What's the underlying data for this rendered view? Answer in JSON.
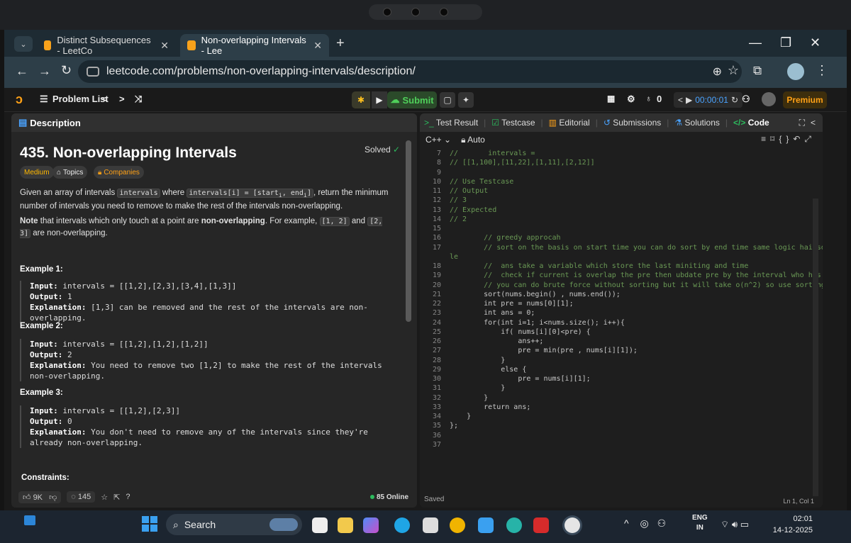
{
  "browser": {
    "tabs": [
      {
        "title": "Distinct Subsequences - LeetCo",
        "active": false
      },
      {
        "title": "Non-overlapping Intervals - Lee",
        "active": true
      }
    ],
    "url": "leetcode.com/problems/non-overlapping-intervals/description/"
  },
  "header": {
    "problem_list": "Problem List",
    "submit": "Submit",
    "streak": "0",
    "timer": "00:00:01",
    "premium": "Premium"
  },
  "left": {
    "tab": "Description",
    "title": "435. Non-overlapping Intervals",
    "solved": "Solved",
    "chips": {
      "difficulty": "Medium",
      "topics": "Topics",
      "companies": "Companies"
    },
    "desc_prefix": "Given an array of intervals",
    "desc_code1": "intervals",
    "desc_mid": "where",
    "desc_code2": "intervals[i] = [start",
    "desc_code2_tail": ", end",
    "desc_code2_end": "]",
    "desc_suffix": ", return the minimum number of intervals you need to remove to make the rest of the intervals non-overlapping.",
    "note_bold": "Note",
    "note_text": "that intervals which only touch at a point are",
    "note_bold2": "non-overlapping",
    "note_text2": ". For example,",
    "note_code1": "[1, 2]",
    "note_and": "and",
    "note_code2": "[2, 3]",
    "note_end": "are non-overlapping.",
    "examples": [
      {
        "title": "Example 1:",
        "input": "intervals = [[1,2],[2,3],[3,4],[1,3]]",
        "output": "1",
        "explanation": "[1,3] can be removed and the rest of the intervals are non-overlapping."
      },
      {
        "title": "Example 2:",
        "input": "intervals = [[1,2],[1,2],[1,2]]",
        "output": "2",
        "explanation": "You need to remove two [1,2] to make the rest of the intervals non-overlapping."
      },
      {
        "title": "Example 3:",
        "input": "intervals = [[1,2],[2,3]]",
        "output": "0",
        "explanation": "You don't need to remove any of the intervals since they're already non-overlapping."
      }
    ],
    "labels": {
      "input": "Input:",
      "output": "Output:",
      "explanation": "Explanation:"
    },
    "constraints": "Constraints:",
    "footer": {
      "likes": "9K",
      "comments": "145",
      "online": "85 Online"
    }
  },
  "right": {
    "tabs": {
      "test_result": "Test Result",
      "testcase": "Testcase",
      "editorial": "Editorial",
      "submissions": "Submissions",
      "solutions": "Solutions",
      "code": "Code"
    },
    "language": "C++",
    "auto": "Auto",
    "saved": "Saved",
    "cursor": "Ln 1, Col 1",
    "lines": [
      {
        "n": "7",
        "text": "//       intervals =",
        "kind": "cm"
      },
      {
        "n": "8",
        "text": "// [[1,100],[11,22],[1,11],[2,12]]",
        "kind": "cm"
      },
      {
        "n": "9",
        "text": "",
        "kind": "cm"
      },
      {
        "n": "10",
        "text": "// Use Testcase",
        "kind": "cm"
      },
      {
        "n": "11",
        "text": "// Output",
        "kind": "cm"
      },
      {
        "n": "12",
        "text": "// 3",
        "kind": "cm"
      },
      {
        "n": "13",
        "text": "// Expected",
        "kind": "cm"
      },
      {
        "n": "14",
        "text": "// 2",
        "kind": "cm"
      },
      {
        "n": "15",
        "text": "",
        "kind": "cm"
      },
      {
        "n": "16",
        "text": "        // greedy approcah",
        "kind": "cm"
      },
      {
        "n": "17",
        "text": "        // sort on the basis on start time you can do sort by end time same logic hai soch ke kr",
        "kind": "cm"
      },
      {
        "n": "",
        "text": "le",
        "kind": "cm"
      },
      {
        "n": "18",
        "text": "        //  ans take a variable which store the last miniting and time",
        "kind": "cm"
      },
      {
        "n": "19",
        "text": "        //  check if current is overlap the pre then ubdate pre by the interval who has min range",
        "kind": "cm"
      },
      {
        "n": "20",
        "text": "        // you can do brute force without sorting but it will take o(n^2) so use sorting",
        "kind": "cm"
      },
      {
        "n": "21",
        "text": "        sort(nums.begin() , nums.end());",
        "kind": "code"
      },
      {
        "n": "22",
        "text": "        int pre = nums[0][1];",
        "kind": "code"
      },
      {
        "n": "23",
        "text": "        int ans = 0;",
        "kind": "code"
      },
      {
        "n": "24",
        "text": "        for(int i=1; i<nums.size(); i++){",
        "kind": "code"
      },
      {
        "n": "25",
        "text": "            if( nums[i][0]<pre) {",
        "kind": "code"
      },
      {
        "n": "26",
        "text": "                ans++;",
        "kind": "code"
      },
      {
        "n": "27",
        "text": "                pre = min(pre , nums[i][1]);",
        "kind": "code"
      },
      {
        "n": "28",
        "text": "            }",
        "kind": "code"
      },
      {
        "n": "29",
        "text": "            else {",
        "kind": "code"
      },
      {
        "n": "30",
        "text": "                pre = nums[i][1];",
        "kind": "code"
      },
      {
        "n": "31",
        "text": "            }",
        "kind": "code"
      },
      {
        "n": "32",
        "text": "        }",
        "kind": "code"
      },
      {
        "n": "33",
        "text": "        return ans;",
        "kind": "code"
      },
      {
        "n": "34",
        "text": "    }",
        "kind": "code"
      },
      {
        "n": "35",
        "text": "};",
        "kind": "code"
      },
      {
        "n": "36",
        "text": "",
        "kind": "code"
      },
      {
        "n": "37",
        "text": "",
        "kind": "code"
      }
    ]
  },
  "taskbar": {
    "search": "Search",
    "lang_top": "ENG",
    "lang_bottom": "IN",
    "time": "02:01",
    "date": "14-12-2025"
  },
  "colors": {
    "brand": "#ffa116",
    "accept": "#2cbb5d",
    "comment": "#6a9955",
    "keyword": "#569cd6"
  }
}
